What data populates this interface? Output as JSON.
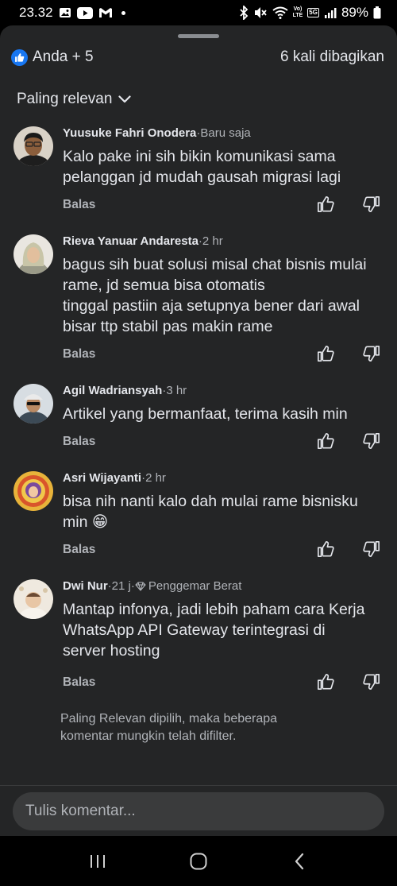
{
  "status_bar": {
    "time": "23.32",
    "battery": "89%",
    "net_top": "Vo)",
    "net_bottom": "LTE",
    "badge": "5G"
  },
  "header": {
    "reactors": "Anda + 5",
    "shares": "6 kali dibagikan"
  },
  "sort": {
    "label": "Paling relevan"
  },
  "comments": [
    {
      "name": "Yuusuke Fahri Onodera",
      "sep": " · ",
      "time": "Baru saja",
      "lines": [
        "Kalo pake ini sih bikin komunikasi sama",
        "pelanggan jd mudah gausah migrasi lagi"
      ],
      "reply": "Balas"
    },
    {
      "name": "Rieva Yanuar Andaresta",
      "sep": " · ",
      "time": "2 hr",
      "lines": [
        "bagus sih buat solusi misal chat bisnis mulai",
        "rame, jd semua bisa otomatis",
        "tinggal pastiin aja setupnya bener dari awal",
        "bisar ttp stabil pas makin rame"
      ],
      "reply": "Balas"
    },
    {
      "name": "Agil Wadriansyah",
      "sep": " · ",
      "time": "3 hr",
      "lines": [
        "Artikel yang bermanfaat, terima kasih min"
      ],
      "reply": "Balas"
    },
    {
      "name": "Asri Wijayanti",
      "sep": " · ",
      "time": "2 hr",
      "lines": [
        "bisa nih nanti kalo dah mulai rame bisnisku",
        "min"
      ],
      "emoji": "😁",
      "reply": "Balas"
    },
    {
      "name": "Dwi Nur",
      "sep": " · ",
      "time": "21 j",
      "badge": "Penggemar Berat",
      "lines": [
        "Mantap infonya, jadi lebih paham cara Kerja",
        "WhatsApp API Gateway terintegrasi di",
        "server hosting"
      ],
      "reply": "Balas"
    }
  ],
  "footnote": [
    "Paling Relevan dipilih, maka beberapa",
    "komentar mungkin telah difilter."
  ],
  "composer": {
    "placeholder": "Tulis komentar..."
  },
  "colors": {
    "sheet": "#242526",
    "like_blue": "#1877f2",
    "muted": "#b0b3b8",
    "text": "#e4e6eb"
  }
}
